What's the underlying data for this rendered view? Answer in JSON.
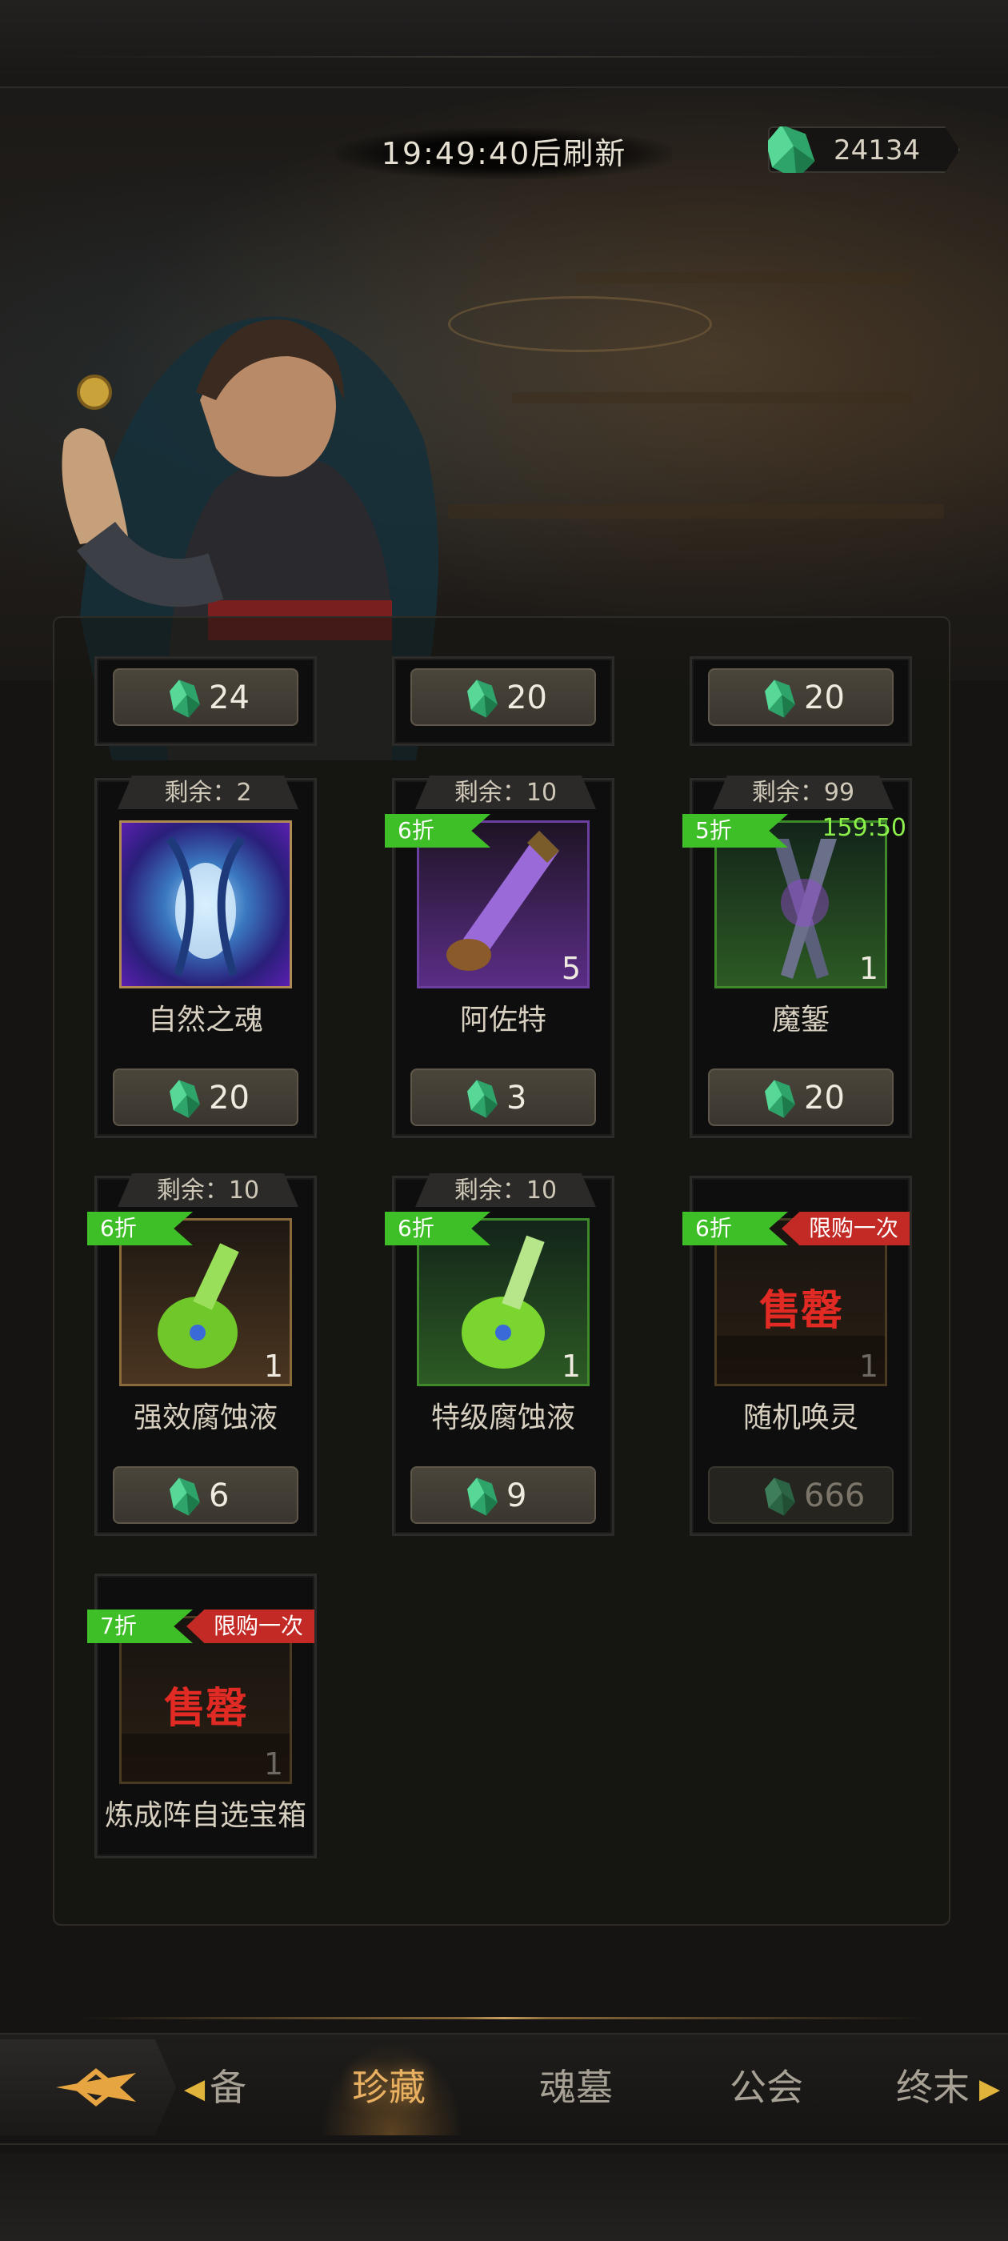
{
  "header": {
    "refresh_text": "19:49:40后刷新",
    "currency_value": "24134",
    "currency_icon": "green-crystal-icon"
  },
  "colors": {
    "discount_tag": "#3fbf27",
    "limit_tag": "#c32a25",
    "sold_out": "#e02a23",
    "timer": "#8cf04a",
    "nav_active": "#e8b060"
  },
  "shop": {
    "partial_row": [
      {
        "price": "24"
      },
      {
        "price": "20"
      },
      {
        "price": "20"
      }
    ],
    "items": [
      {
        "remaining": "剩余：2",
        "name": "自然之魂",
        "price": "20",
        "count": "",
        "discount": "",
        "timer": "",
        "limit": "",
        "sold_out": ""
      },
      {
        "remaining": "剩余：10",
        "name": "阿佐特",
        "price": "3",
        "count": "5",
        "discount": "6折",
        "timer": "",
        "limit": "",
        "sold_out": ""
      },
      {
        "remaining": "剩余：99",
        "name": "魔錾",
        "price": "20",
        "count": "1",
        "discount": "5折",
        "timer": "159:50",
        "limit": "",
        "sold_out": ""
      },
      {
        "remaining": "剩余：10",
        "name": "强效腐蚀液",
        "price": "6",
        "count": "1",
        "discount": "6折",
        "timer": "",
        "limit": "",
        "sold_out": ""
      },
      {
        "remaining": "剩余：10",
        "name": "特级腐蚀液",
        "price": "9",
        "count": "1",
        "discount": "6折",
        "timer": "",
        "limit": "",
        "sold_out": ""
      },
      {
        "remaining": "",
        "name": "随机唤灵",
        "price": "666",
        "count": "1",
        "discount": "6折",
        "timer": "",
        "limit": "限购一次",
        "sold_out": "售罄"
      },
      {
        "remaining": "",
        "name": "炼成阵自选宝箱",
        "price": "",
        "count": "1",
        "discount": "7折",
        "timer": "",
        "limit": "限购一次",
        "sold_out": "售罄"
      }
    ]
  },
  "nav": {
    "tabs": [
      "备",
      "珍藏",
      "魂墓",
      "公会",
      "终末"
    ],
    "active": "珍藏"
  }
}
